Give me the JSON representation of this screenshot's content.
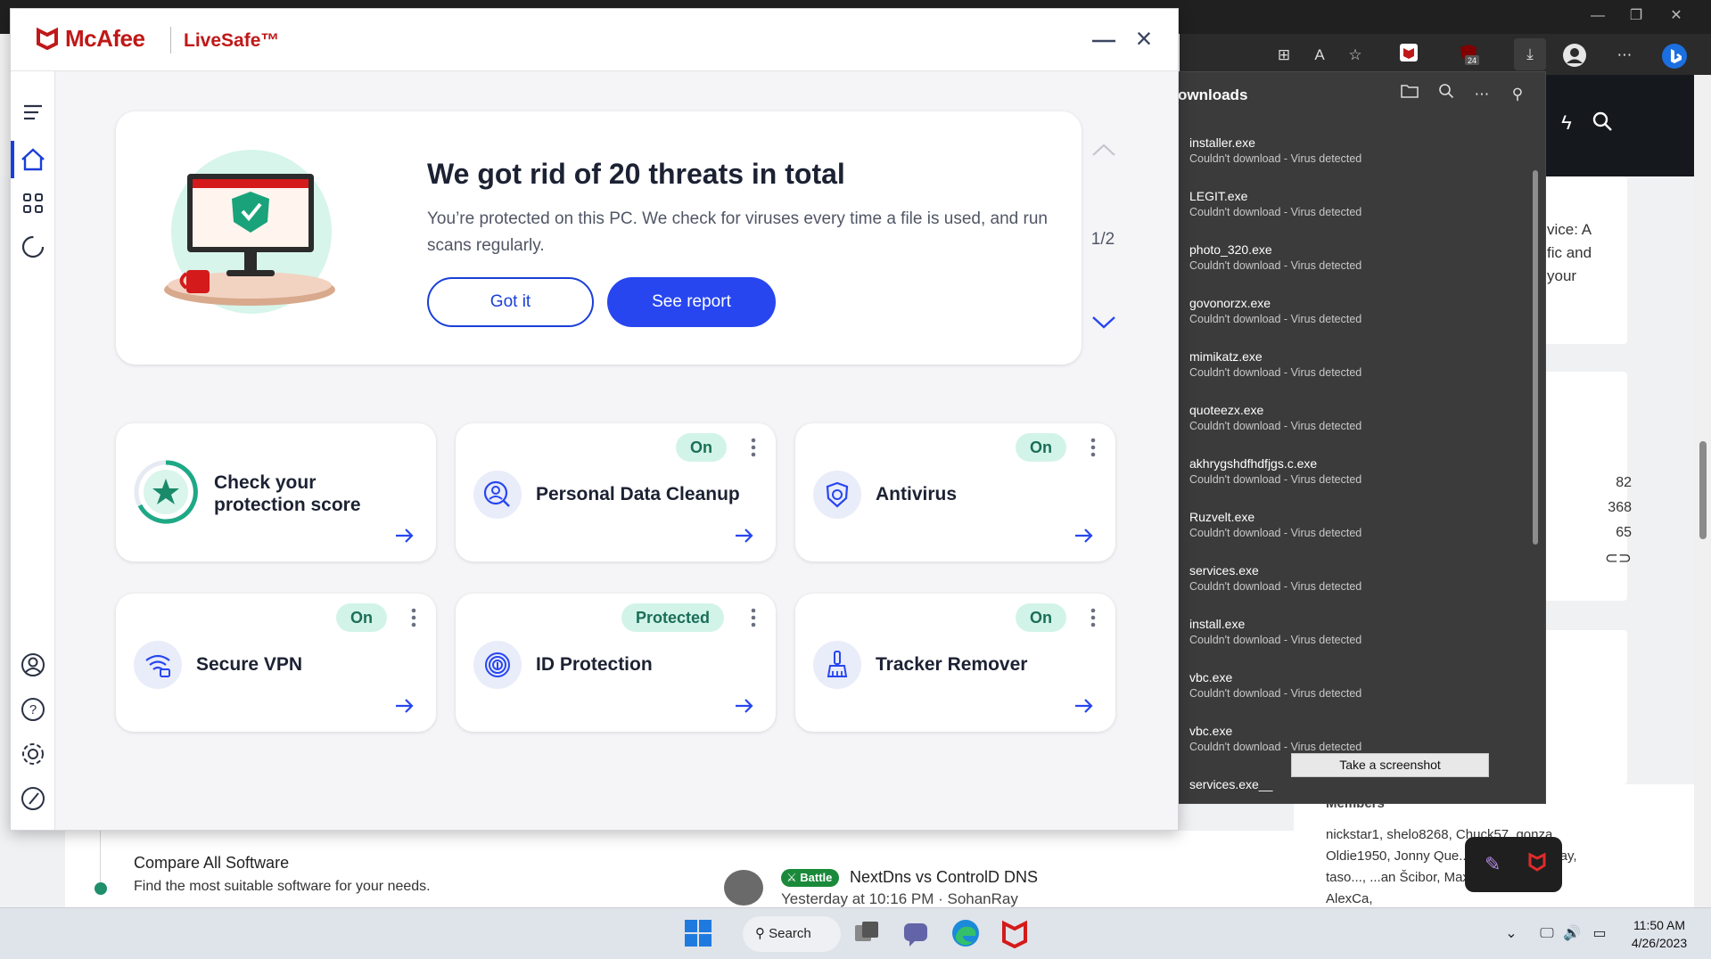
{
  "browser": {
    "downloads_panel": {
      "title": "ownloads",
      "items": [
        {
          "name": "installer.exe",
          "status": "Couldn't download - Virus detected"
        },
        {
          "name": "LEGIT.exe",
          "status": "Couldn't download - Virus detected"
        },
        {
          "name": "photo_320.exe",
          "status": "Couldn't download - Virus detected"
        },
        {
          "name": "govonorzx.exe",
          "status": "Couldn't download - Virus detected"
        },
        {
          "name": "mimikatz.exe",
          "status": "Couldn't download - Virus detected"
        },
        {
          "name": "quoteezx.exe",
          "status": "Couldn't download - Virus detected"
        },
        {
          "name": "akhrygshdfhdfjgs.c.exe",
          "status": "Couldn't download - Virus detected"
        },
        {
          "name": "Ruzvelt.exe",
          "status": "Couldn't download - Virus detected"
        },
        {
          "name": "services.exe",
          "status": "Couldn't download - Virus detected"
        },
        {
          "name": "install.exe",
          "status": "Couldn't download - Virus detected"
        },
        {
          "name": "vbc.exe",
          "status": "Couldn't download - Virus detected"
        },
        {
          "name": "vbc.exe",
          "status": "Couldn't download - Virus detected"
        },
        {
          "name": "services.exe__",
          "status": ""
        }
      ],
      "tooltip": "Take a screenshot"
    },
    "extension_badge": "24",
    "page": {
      "right_card_text": [
        "vice: A",
        "fic and",
        "your"
      ],
      "stats": [
        "82",
        "368",
        "65"
      ],
      "compare_title": "Compare All Software",
      "compare_sub": "Find the most suitable software for your needs.",
      "battle_badge": "Battle",
      "battle_title": "NextDns vs ControlD DNS",
      "battle_meta": "Yesterday at 10:16 PM · SohanRay",
      "members_head": "Members",
      "members_list": "nickstar1, shelo8268, Chuck57, gonza, Oldie1950, Jonny Que..., sakil, SohanRay, taso..., ...an Šcibor, Max90, Dhruv2193, AlexCa,"
    }
  },
  "mcafee": {
    "brand": "McAfee",
    "product": "LiveSafe™",
    "hero": {
      "title": "We got rid of 20 threats in total",
      "description": "You’re protected on this PC. We check for viruses every time a file is used, and run scans regularly.",
      "btn_gotit": "Got it",
      "btn_report": "See report",
      "page": "1/2"
    },
    "cards": [
      {
        "title": "Check your protection score",
        "badge": ""
      },
      {
        "title": "Personal Data Cleanup",
        "badge": "On"
      },
      {
        "title": "Antivirus",
        "badge": "On"
      },
      {
        "title": "Secure VPN",
        "badge": "On"
      },
      {
        "title": "ID Protection",
        "badge": "Protected"
      },
      {
        "title": "Tracker Remover",
        "badge": "On"
      }
    ],
    "colors": {
      "brand_red": "#c01818",
      "accent_blue": "#2746f0",
      "badge_green": "#d2f4e8"
    }
  },
  "taskbar": {
    "search": "Search",
    "time": "11:50 AM",
    "date": "4/26/2023"
  }
}
